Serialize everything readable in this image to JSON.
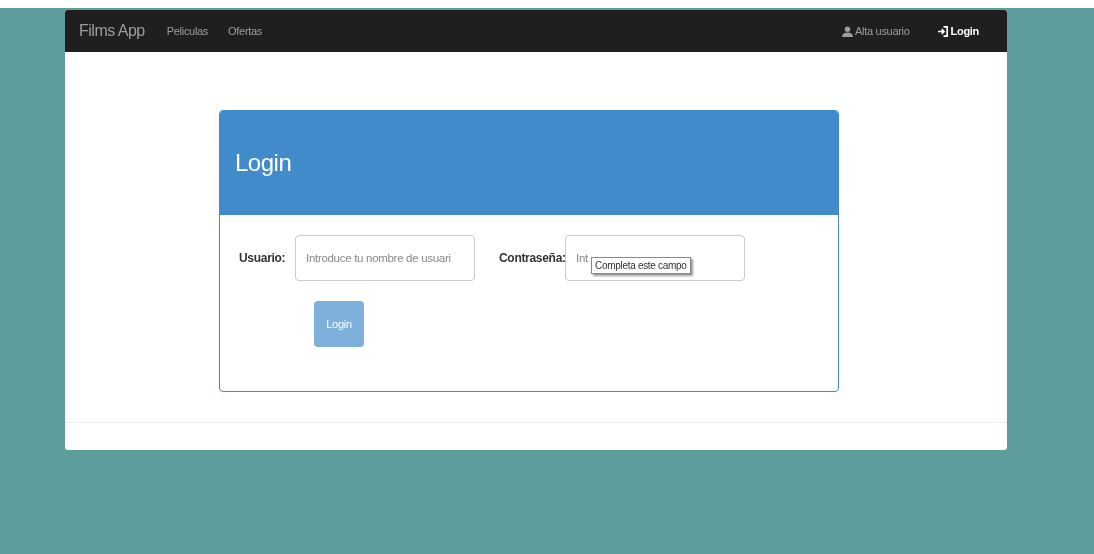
{
  "navbar": {
    "brand": "Films App",
    "links": [
      {
        "label": "Peliculas"
      },
      {
        "label": "Ofertas"
      }
    ],
    "right_links": [
      {
        "label": "Alta usuario",
        "kind": "user"
      },
      {
        "label": "Login",
        "kind": "login"
      }
    ]
  },
  "panel": {
    "title": "Login",
    "fields": [
      {
        "label": "Usuario:",
        "placeholder": "Introduce tu nombre de usuari"
      },
      {
        "label": "Contraseña:",
        "placeholder": "Int"
      }
    ],
    "tooltip": "Completa este campo",
    "button": {
      "label": "Login",
      "disabled": true
    }
  }
}
